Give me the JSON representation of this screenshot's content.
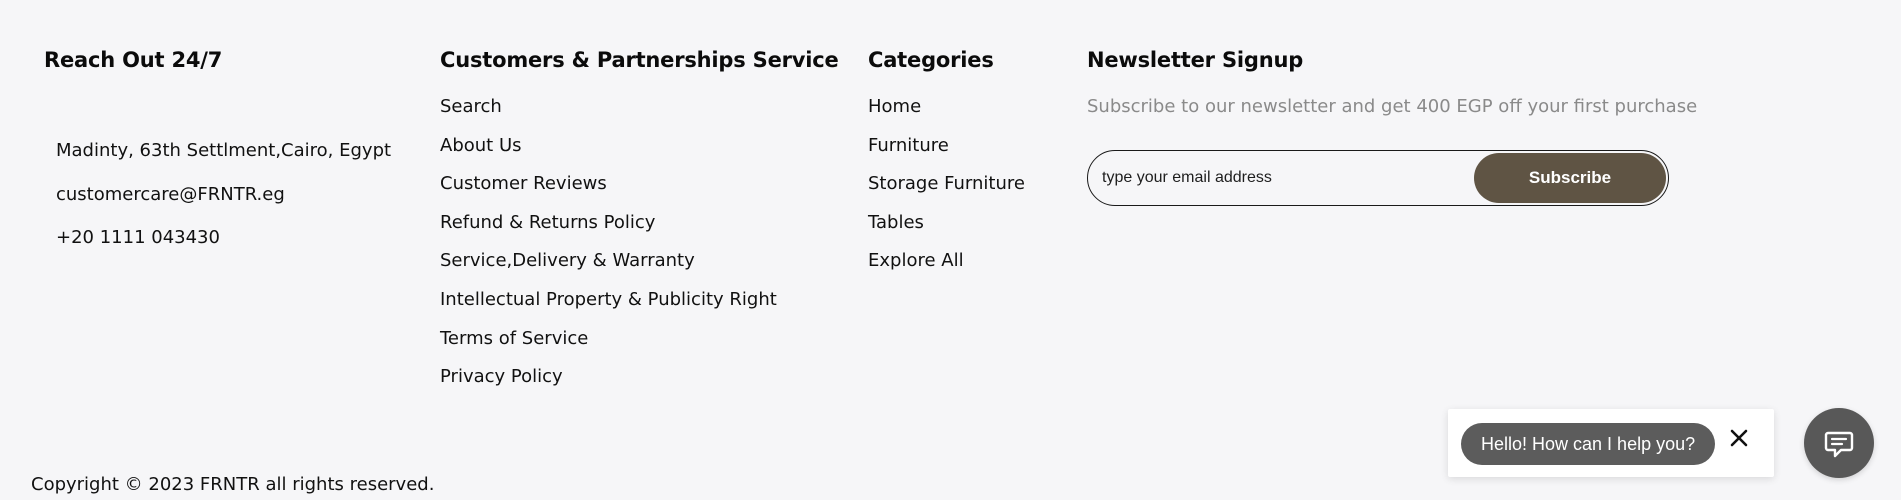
{
  "reach": {
    "title": "Reach Out 24/7",
    "address": "Madinty, 63th Settlment,Cairo, Egypt",
    "email": "customercare@FRNTR.eg",
    "phone": "+20 1111 043430"
  },
  "service": {
    "title": "Customers & Partnerships Service",
    "links": [
      "Search",
      "About Us",
      "Customer Reviews",
      "Refund & Returns Policy",
      "Service,Delivery & Warranty",
      "Intellectual Property & Publicity Right",
      "Terms of Service",
      "Privacy Policy"
    ]
  },
  "categories": {
    "title": "Categories",
    "links": [
      "Home",
      "Furniture",
      "Storage Furniture",
      "Tables",
      "Explore All"
    ]
  },
  "newsletter": {
    "title": "Newsletter Signup",
    "text": "Subscribe to our newsletter and get 400 EGP off your first purchase",
    "email_placeholder": "type your email address",
    "email_value": "",
    "subscribe_label": "Subscribe"
  },
  "footer": {
    "copyright": "Copyright © 2023 FRNTR all rights reserved."
  },
  "chat": {
    "greeting": "Hello! How can I help you?",
    "close_icon": "close-icon",
    "fab_icon": "chat-icon"
  },
  "colors": {
    "background": "#f6f6f8",
    "subscribe_button": "#5f5444",
    "chat_bubble": "#5c5c5c",
    "muted_text": "#8a8a8a"
  }
}
